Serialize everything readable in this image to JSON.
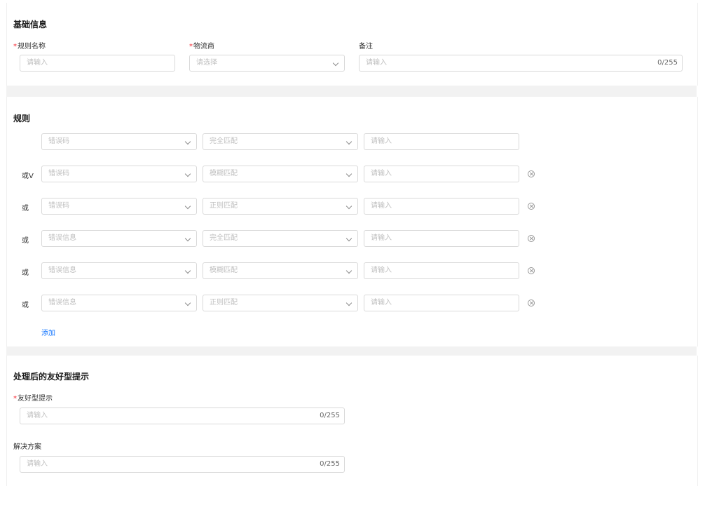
{
  "basic": {
    "title": "基础信息",
    "rule_name": {
      "label": "规则名称",
      "placeholder": "请输入"
    },
    "carrier": {
      "label": "物流商",
      "placeholder": "请选择"
    },
    "remark": {
      "label": "备注",
      "placeholder": "请输入",
      "counter": "0/255"
    }
  },
  "rules": {
    "title": "规则",
    "or_label": "或",
    "or_first_label": "或V",
    "value_placeholder": "请输入",
    "rows": [
      {
        "type": "错误码",
        "match": "完全匹配"
      },
      {
        "type": "错误码",
        "match": "模糊匹配"
      },
      {
        "type": "错误码",
        "match": "正则匹配"
      },
      {
        "type": "错误信息",
        "match": "完全匹配"
      },
      {
        "type": "错误信息",
        "match": "模糊匹配"
      },
      {
        "type": "错误信息",
        "match": "正则匹配"
      }
    ],
    "add_label": "添加"
  },
  "processed": {
    "title": "处理后的友好型提示",
    "friendly_tip": {
      "label": "友好型提示",
      "placeholder": "请输入",
      "counter": "0/255"
    },
    "solution": {
      "label": "解决方案",
      "placeholder": "请输入",
      "counter": "0/255"
    }
  },
  "colors": {
    "required": "#f5222d",
    "link": "#1677ff",
    "border": "#d9d9d9",
    "divider": "#f2f2f2"
  },
  "icons": {
    "select": "chevron-down-icon",
    "remove": "close-circle-icon"
  }
}
